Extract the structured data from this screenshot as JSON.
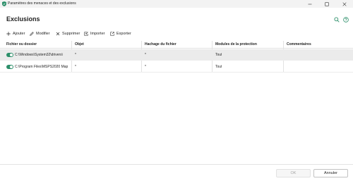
{
  "window": {
    "title": "Paramètres des menaces et des exclusions"
  },
  "header": {
    "title": "Exclusions",
    "search_icon": "search-icon",
    "help_icon": "help-icon"
  },
  "toolbar": {
    "items": [
      {
        "label": "Ajouter",
        "icon": "plus-icon"
      },
      {
        "label": "Modifier",
        "icon": "pencil-icon"
      },
      {
        "label": "Supprimer",
        "icon": "x-icon"
      },
      {
        "label": "Importer",
        "icon": "import-icon"
      },
      {
        "label": "Exporter",
        "icon": "export-icon"
      }
    ]
  },
  "table": {
    "columns": [
      "Fichier ou dossier",
      "Objet",
      "Hachage du fichier",
      "Modules de la protection",
      "Commentaires"
    ],
    "rows": [
      {
        "enabled": true,
        "path": "C:\\Windows\\System32\\drivers\\",
        "object": "*",
        "hash": "*",
        "modules": "Tout",
        "comment": "",
        "selected": true
      },
      {
        "enabled": true,
        "path": "C:\\Program Files\\MSPS2020 Map",
        "object": "*",
        "hash": "*",
        "modules": "Tout",
        "comment": "",
        "selected": false
      }
    ]
  },
  "footer": {
    "ok_label": "OK",
    "cancel_label": "Annuler"
  },
  "colors": {
    "accent": "#2d8f6a",
    "selected_row": "#ebebeb"
  }
}
